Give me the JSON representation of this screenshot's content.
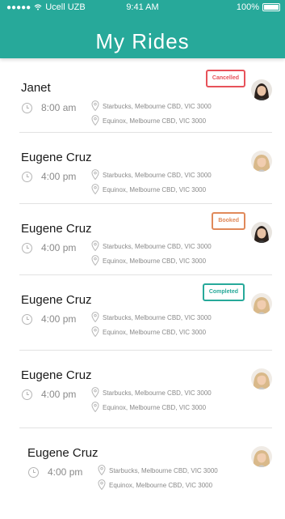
{
  "status_bar": {
    "carrier": "Ucell UZB",
    "time": "9:41 AM",
    "battery": "100%"
  },
  "header": {
    "title": "My Rides"
  },
  "colors": {
    "primary": "#27a99a",
    "cancelled": "#e7525a",
    "booked": "#e0895a",
    "completed": "#27a99a"
  },
  "rides": [
    {
      "name": "Janet",
      "time": "8:00 am",
      "from": "Starbucks, Melbourne CBD, VIC 3000",
      "to": "Equinox, Melbourne CBD, VIC 3000",
      "status": "Cancelled",
      "avatar": "dark-hair"
    },
    {
      "name": "Eugene Cruz",
      "time": "4:00 pm",
      "from": "Starbucks, Melbourne CBD, VIC 3000",
      "to": "Equinox, Melbourne CBD, VIC 3000",
      "status": "",
      "avatar": "blonde-hair"
    },
    {
      "name": "Eugene Cruz",
      "time": "4:00 pm",
      "from": "Starbucks, Melbourne CBD, VIC 3000",
      "to": "Equinox, Melbourne CBD, VIC 3000",
      "status": "Booked",
      "avatar": "dark-hair"
    },
    {
      "name": "Eugene Cruz",
      "time": "4:00 pm",
      "from": "Starbucks, Melbourne CBD, VIC 3000",
      "to": "Equinox, Melbourne CBD, VIC 3000",
      "status": "Completed",
      "avatar": "blonde-hair"
    },
    {
      "name": "Eugene Cruz",
      "time": "4:00 pm",
      "from": "Starbucks, Melbourne CBD, VIC 3000",
      "to": "Equinox, Melbourne CBD, VIC 3000",
      "status": "",
      "avatar": "blonde-hair"
    },
    {
      "name": "Eugene Cruz",
      "time": "4:00 pm",
      "from": "Starbucks, Melbourne CBD, VIC 3000",
      "to": "Equinox, Melbourne CBD, VIC 3000",
      "status": "",
      "avatar": "blonde-hair"
    }
  ]
}
